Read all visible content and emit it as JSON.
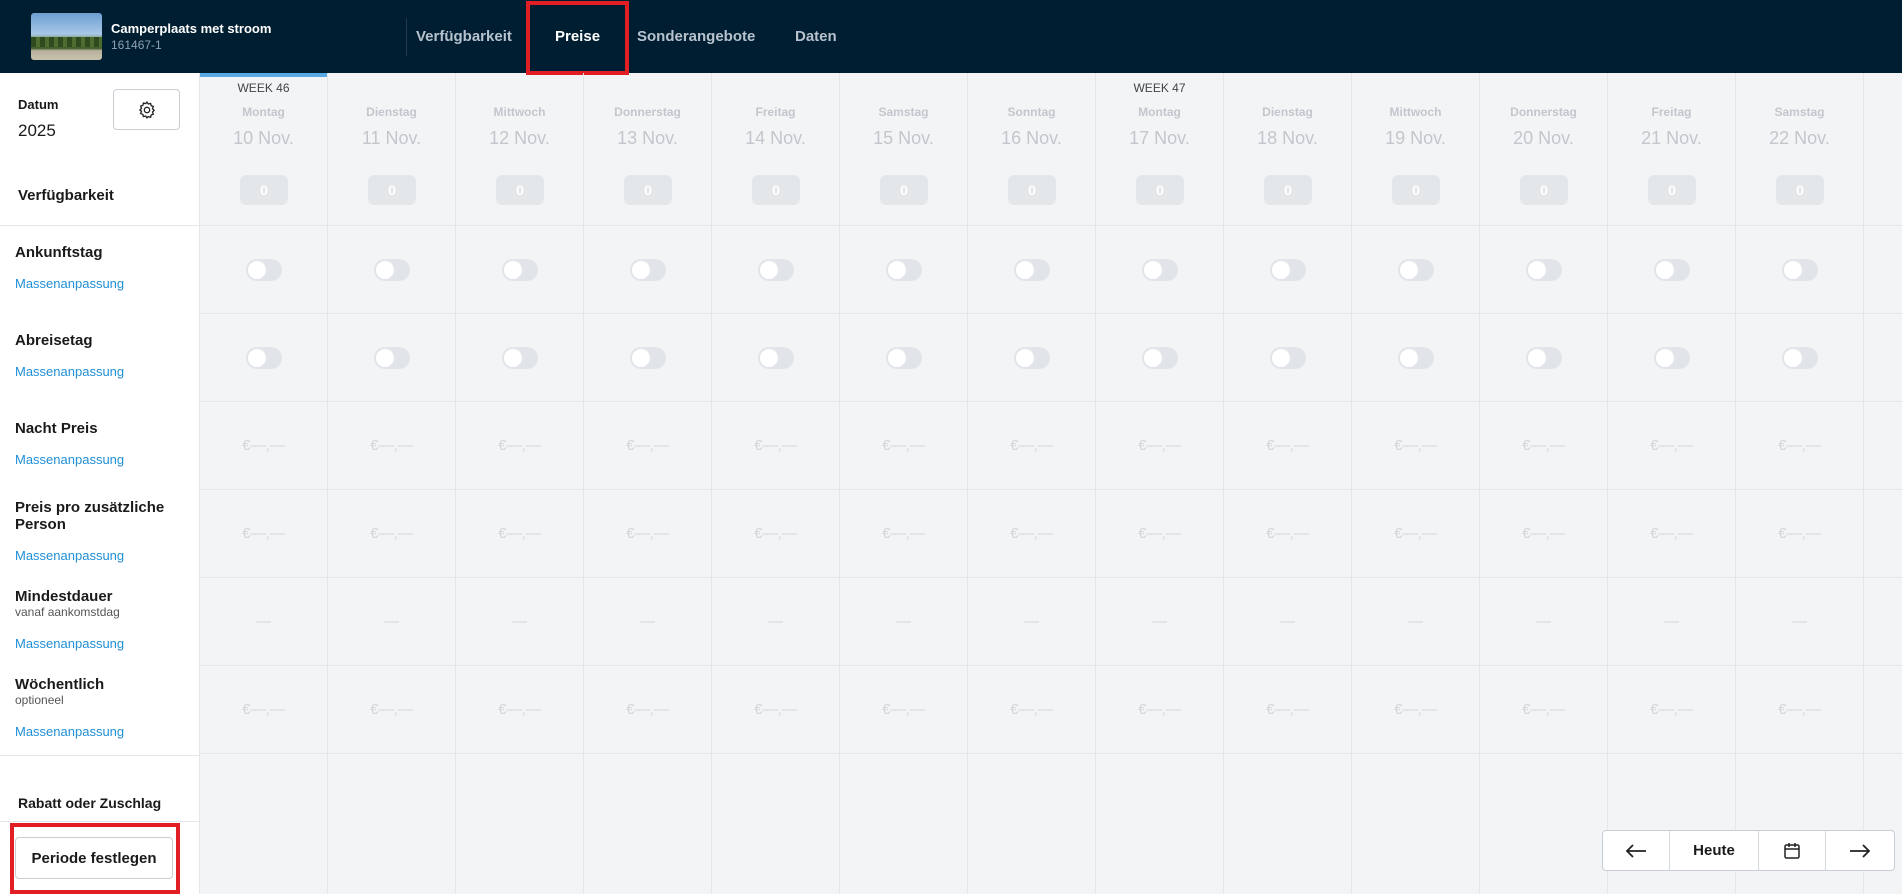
{
  "header": {
    "property_title": "Camperplaats met stroom",
    "property_id": "161467-1",
    "tabs": [
      {
        "label": "Verfügbarkeit",
        "active": false
      },
      {
        "label": "Preise",
        "active": true
      },
      {
        "label": "Sonderangebote",
        "active": false
      },
      {
        "label": "Daten",
        "active": false
      }
    ]
  },
  "sidebar": {
    "date_label": "Datum",
    "year": "2025",
    "availability_label": "Verfügbarkeit",
    "rows": [
      {
        "label": "Ankunftstag",
        "sub": "",
        "link": "Massenanpassung"
      },
      {
        "label": "Abreisetag",
        "sub": "",
        "link": "Massenanpassung"
      },
      {
        "label": "Nacht Preis",
        "sub": "",
        "link": "Massenanpassung"
      },
      {
        "label": "Preis pro zusätzliche Person",
        "sub": "",
        "link": "Massenanpassung"
      },
      {
        "label": "Mindestdauer",
        "sub": "vanaf aankomstdag",
        "link": "Massenanpassung"
      },
      {
        "label": "Wöchentlich",
        "sub": "optioneel",
        "link": "Massenanpassung"
      }
    ],
    "discount_label": "Rabatt oder Zuschlag",
    "period_button": "Periode festlegen"
  },
  "calendar": {
    "placeholders": {
      "price": "€—,—",
      "duration": "—"
    },
    "days": [
      {
        "week": "WEEK 46",
        "day": "Montag",
        "date": "10 Nov.",
        "available": "0"
      },
      {
        "week": "",
        "day": "Dienstag",
        "date": "11 Nov.",
        "available": "0"
      },
      {
        "week": "",
        "day": "Mittwoch",
        "date": "12 Nov.",
        "available": "0"
      },
      {
        "week": "",
        "day": "Donnerstag",
        "date": "13 Nov.",
        "available": "0"
      },
      {
        "week": "",
        "day": "Freitag",
        "date": "14 Nov.",
        "available": "0"
      },
      {
        "week": "",
        "day": "Samstag",
        "date": "15 Nov.",
        "available": "0"
      },
      {
        "week": "",
        "day": "Sonntag",
        "date": "16 Nov.",
        "available": "0"
      },
      {
        "week": "WEEK 47",
        "day": "Montag",
        "date": "17 Nov.",
        "available": "0"
      },
      {
        "week": "",
        "day": "Dienstag",
        "date": "18 Nov.",
        "available": "0"
      },
      {
        "week": "",
        "day": "Mittwoch",
        "date": "19 Nov.",
        "available": "0"
      },
      {
        "week": "",
        "day": "Donnerstag",
        "date": "20 Nov.",
        "available": "0"
      },
      {
        "week": "",
        "day": "Freitag",
        "date": "21 Nov.",
        "available": "0"
      },
      {
        "week": "",
        "day": "Samstag",
        "date": "22 Nov.",
        "available": "0"
      }
    ]
  },
  "nav": {
    "prev_icon": "arrow-left-icon",
    "today_label": "Heute",
    "calendar_icon": "calendar-icon",
    "next_icon": "arrow-right-icon"
  },
  "colors": {
    "topbar": "#001e31",
    "highlight": "#e01e24",
    "link": "#1f8fd6",
    "week_marker": "#5aa8e4"
  }
}
